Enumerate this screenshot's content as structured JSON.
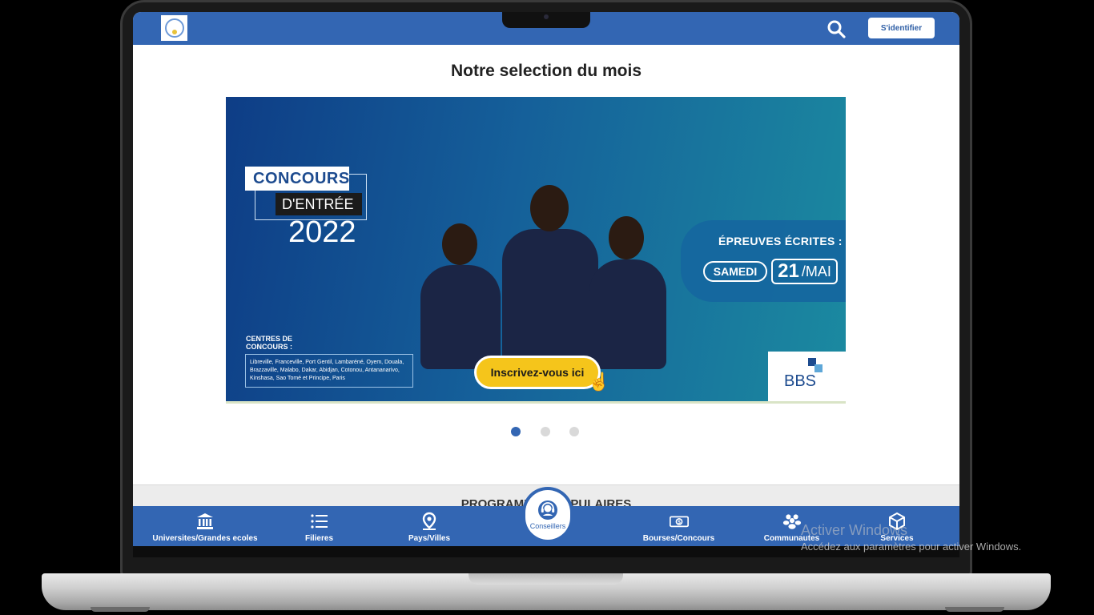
{
  "header": {
    "login_label": "S'identifier"
  },
  "main": {
    "section_title": "Notre selection du mois",
    "programs_title": "PROGRAMMES POPULAIRES"
  },
  "banner": {
    "concours": "CONCOURS",
    "entree": "D'ENTRÉE",
    "year": "2022",
    "centres_title": "CENTRES DE CONCOURS :",
    "centres_list": "Libreville, Franceville, Port Gentil, Lambaréné, Oyem, Douala, Brazzaville, Malabo, Dakar, Abidjan, Cotonou, Antananarivo, Kinshasa, Sao Tomé et Principe, Paris",
    "cta_label": "Inscrivez-vous ici",
    "epreuves_label": "ÉPREUVES ÉCRITES :",
    "samedi": "SAMEDI",
    "date_day": "21",
    "date_month": "/MAI",
    "brand": "BBS"
  },
  "carousel": {
    "slide_count": 3,
    "active_slide": 1
  },
  "bottom_nav": {
    "items": [
      {
        "label": "Universites/Grandes ecoles",
        "icon": "university-icon"
      },
      {
        "label": "Filieres",
        "icon": "list-icon"
      },
      {
        "label": "Pays/Villes",
        "icon": "map-pin-icon"
      },
      {
        "label": "Bourses/Concours",
        "icon": "money-icon"
      },
      {
        "label": "Communautes",
        "icon": "users-icon"
      },
      {
        "label": "Services",
        "icon": "cube-icon"
      }
    ],
    "center_label": "Conseillers",
    "center_icon": "headset-icon"
  },
  "windows_watermark": {
    "title": "Activer Windows",
    "subtitle": "Accédez aux paramètres pour activer Windows."
  },
  "colors": {
    "primary": "#3366b3",
    "cta": "#f5c51b"
  }
}
